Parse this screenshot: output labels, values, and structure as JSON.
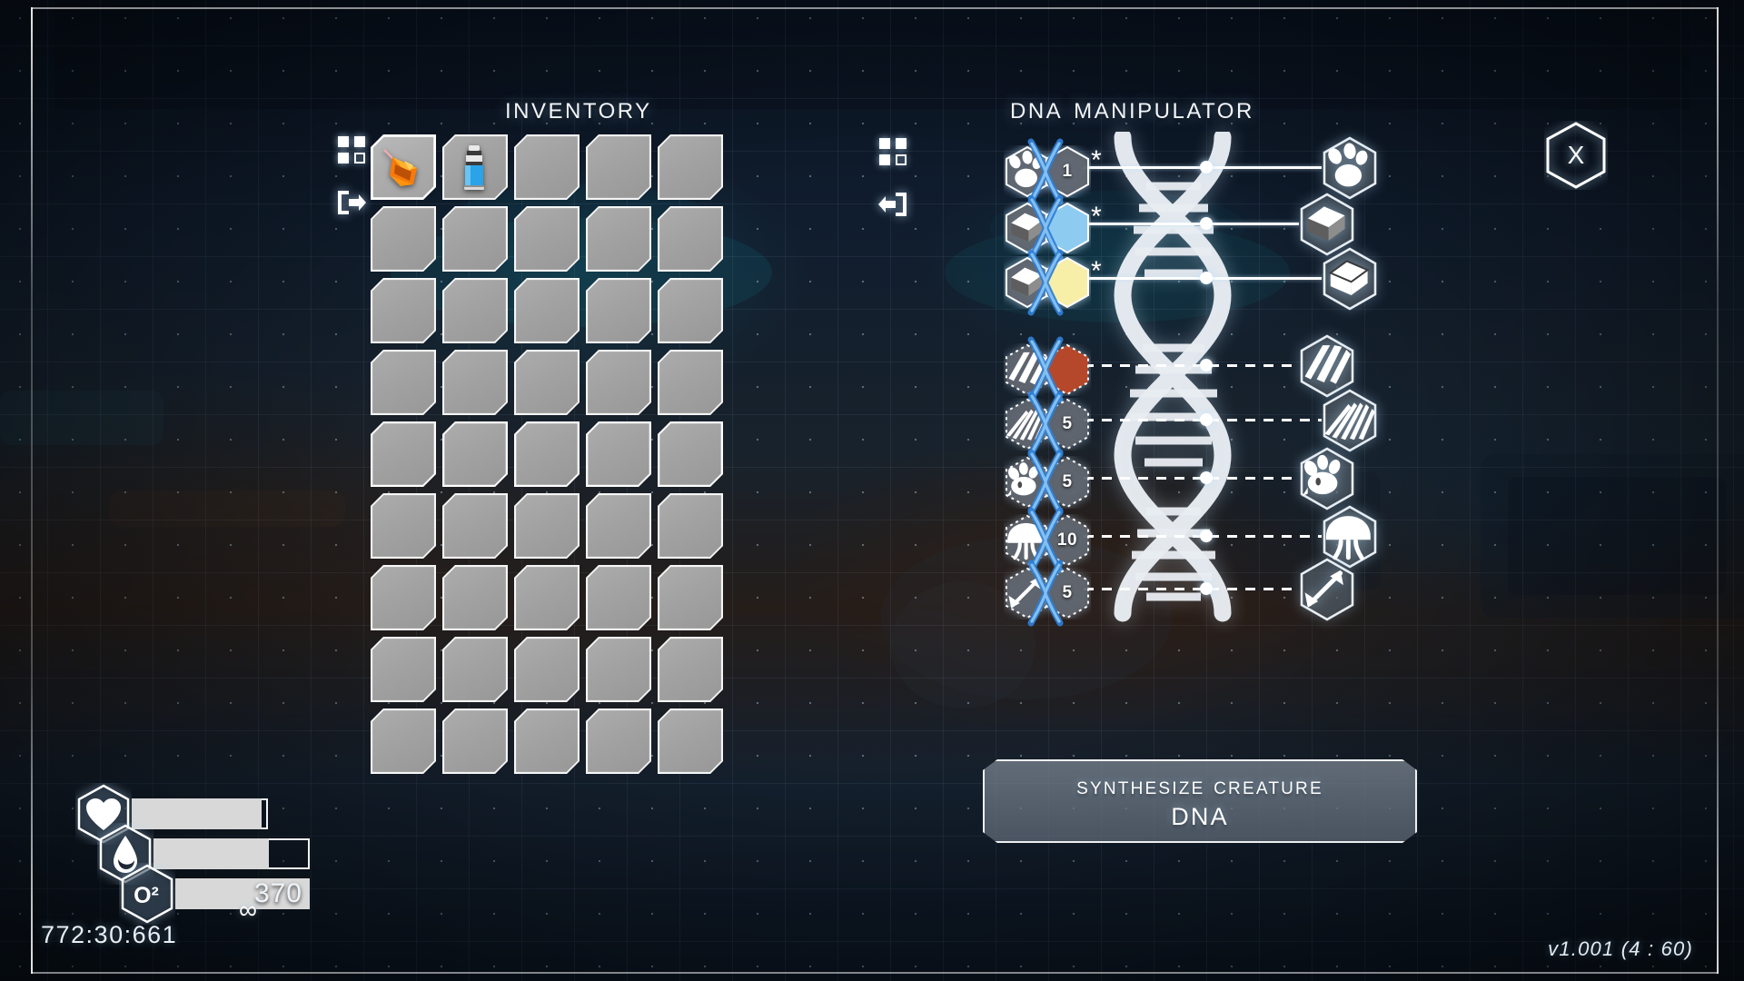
{
  "window": {
    "version": "v1.001 (4 : 60)"
  },
  "inventory": {
    "title": "Inventory",
    "columns": 5,
    "rows": 9,
    "controls": [
      {
        "name": "grid-view-icon",
        "label": "grid-view-icon"
      },
      {
        "name": "exit-icon",
        "label": "exit-right-icon"
      }
    ],
    "items": [
      {
        "slot": 0,
        "icon": "orange-meat-chunk",
        "selected": true
      },
      {
        "slot": 1,
        "icon": "blue-spray-bottle",
        "selected": false
      }
    ],
    "highlighted_row": 4
  },
  "dna": {
    "title": "DNA Manipulator",
    "controls": [
      {
        "name": "grid-view-icon",
        "label": "grid-view-icon"
      },
      {
        "name": "back-icon",
        "label": "exit-left-icon"
      }
    ],
    "genes": [
      {
        "left_icon": "paw-print-icon",
        "right_icon": "badge-number",
        "badge": "1",
        "marker": "*",
        "locked": false,
        "line": "solid",
        "result_icon": "paw-print-icon"
      },
      {
        "left_icon": "block-gray-icon",
        "right_icon": "hex-blue",
        "badge": "",
        "marker": "*",
        "locked": false,
        "line": "solid",
        "result_icon": "block-gray-icon"
      },
      {
        "left_icon": "block-gray-icon",
        "right_icon": "hex-yellow",
        "badge": "",
        "marker": "*",
        "locked": false,
        "line": "solid",
        "result_icon": "block-white-icon"
      },
      {
        "left_icon": "stripes-icon",
        "right_icon": "hex-orange",
        "badge": "",
        "marker": "",
        "locked": true,
        "line": "dashed",
        "result_icon": "stripes-icon"
      },
      {
        "left_icon": "rays-icon",
        "right_icon": "badge-number",
        "badge": "5",
        "marker": "",
        "locked": true,
        "line": "dashed",
        "result_icon": "rays-icon"
      },
      {
        "left_icon": "creature-icon",
        "right_icon": "badge-number",
        "badge": "5",
        "marker": "",
        "locked": true,
        "line": "dashed",
        "result_icon": "creature-icon"
      },
      {
        "left_icon": "mushroom-icon",
        "right_icon": "badge-number",
        "badge": "10",
        "marker": "",
        "locked": true,
        "line": "dashed",
        "result_icon": "mushroom-icon"
      },
      {
        "left_icon": "arrow-size-icon",
        "right_icon": "badge-number",
        "badge": "5",
        "marker": "",
        "locked": true,
        "line": "dashed",
        "result_icon": "arrow-size-icon"
      }
    ],
    "synthesize_button": {
      "line1": "Synthesize creature",
      "line2": "DNA"
    }
  },
  "close_button": {
    "glyph": "X",
    "name": "close-icon"
  },
  "hud": {
    "health": {
      "icon": "heart-icon",
      "fill_percent": 95,
      "value": ""
    },
    "water": {
      "icon": "water-drop-icon",
      "fill_percent": 74,
      "value": ""
    },
    "oxygen": {
      "icon": "O²",
      "fill_percent": 100,
      "value": "370"
    },
    "infinity": "∞",
    "timer": "772:30:661"
  },
  "colors": {
    "hex_blue": "#8ecbf0",
    "hex_yellow": "#f7eea8",
    "hex_orange": "#b5482a",
    "slot_gray": "#a6a6a6",
    "accent_white": "#ffffff",
    "bar_fill": "#d8d8d8"
  }
}
